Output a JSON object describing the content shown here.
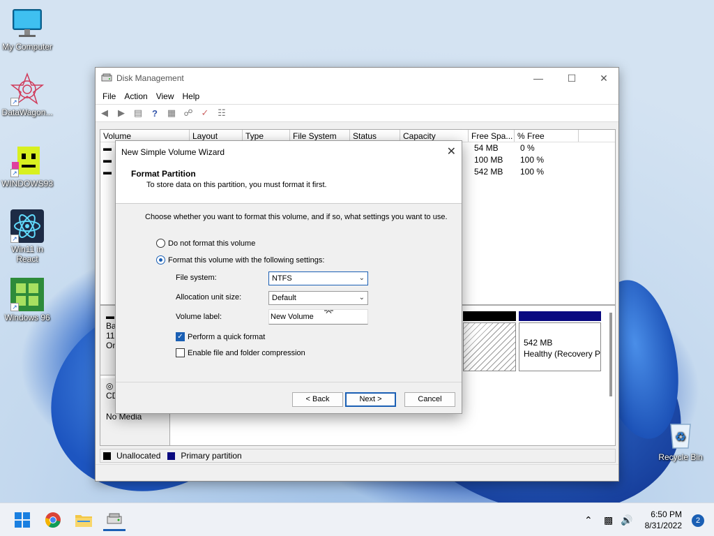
{
  "desktop": {
    "icons": [
      {
        "label": "My Computer"
      },
      {
        "label": "DataWagon..."
      },
      {
        "label": "WINDOWS93"
      },
      {
        "label": "Win11 in\nReact"
      },
      {
        "label": "Windows 96"
      },
      {
        "label": "Recycle Bin"
      }
    ]
  },
  "disk_management": {
    "title": "Disk Management",
    "menu": [
      "File",
      "Action",
      "View",
      "Help"
    ],
    "columns": [
      "Volume",
      "Layout",
      "Type",
      "File System",
      "Status",
      "Capacity",
      "Free Spa...",
      "% Free"
    ],
    "rows": [
      {
        "free": "54 MB",
        "pct": "0 %"
      },
      {
        "free": "100 MB",
        "pct": "100 %"
      },
      {
        "free": "542 MB",
        "pct": "100 %"
      }
    ],
    "disk0_partial": [
      "Bas",
      "119",
      "On"
    ],
    "partition_size": "542 MB",
    "partition_status": "Healthy (Recovery P",
    "cdrom_label": "CD",
    "cdrom_status": "No Media",
    "legend": {
      "unallocated": "Unallocated",
      "primary": "Primary partition"
    }
  },
  "wizard": {
    "title": "New Simple Volume Wizard",
    "heading": "Format Partition",
    "subheading": "To store data on this partition, you must format it first.",
    "intro": "Choose whether you want to format this volume, and if so, what settings you want to use.",
    "option_no_format": "Do not format this volume",
    "option_format": "Format this volume with the following settings:",
    "file_system_label": "File system:",
    "file_system_value": "NTFS",
    "alloc_label": "Allocation unit size:",
    "alloc_value": "Default",
    "volume_label_label": "Volume label:",
    "volume_label_value": "New Volume",
    "quick_format": "Perform a quick format",
    "compression": "Enable file and folder compression",
    "back": "< Back",
    "next": "Next >",
    "cancel": "Cancel"
  },
  "taskbar": {
    "time": "6:50 PM",
    "date": "8/31/2022",
    "notifications": "2"
  }
}
